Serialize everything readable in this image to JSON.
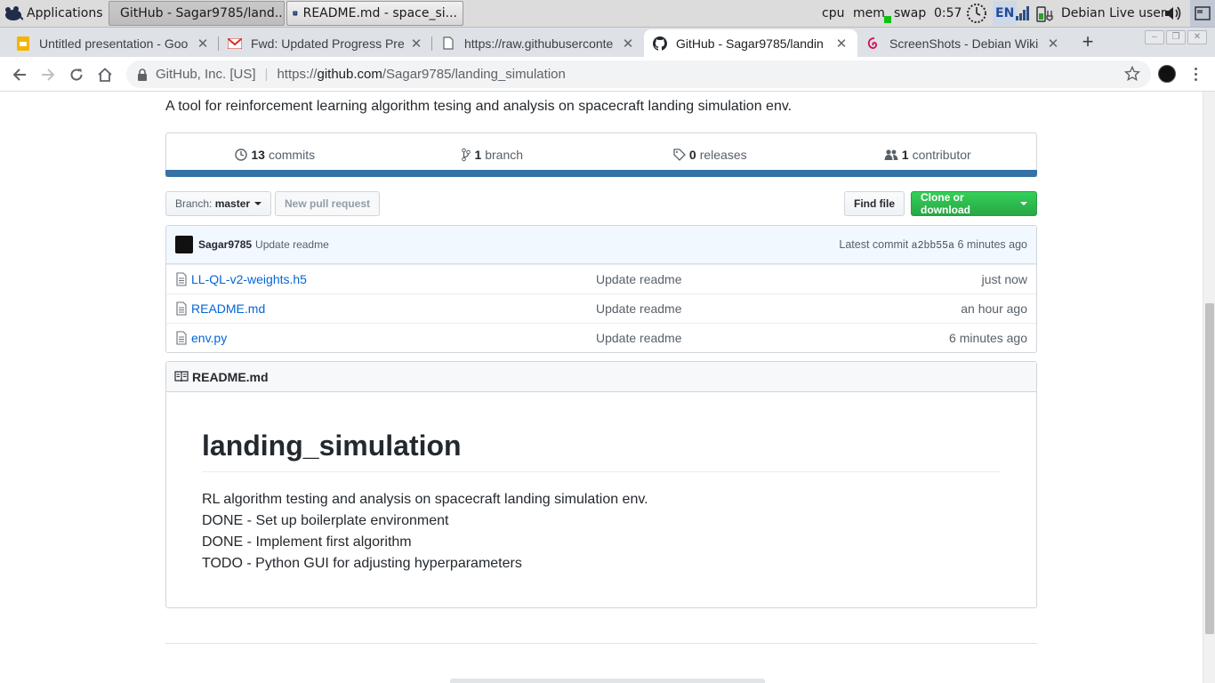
{
  "panel": {
    "applications_label": "Applications",
    "tasks": [
      {
        "label": "GitHub - Sagar9785/land..."
      },
      {
        "label": "README.md - space_si..."
      }
    ],
    "cpu_label": "cpu",
    "mem_label": "mem",
    "swap_label": "swap",
    "clock": "0:57",
    "keyboard_layout": "EN",
    "user": "Debian Live user"
  },
  "browser": {
    "tabs": [
      {
        "title": "Untitled presentation - Goo",
        "icon": "slides-icon"
      },
      {
        "title": "Fwd: Updated Progress Pre",
        "icon": "gmail-icon"
      },
      {
        "title": "https://raw.githubuserconte",
        "icon": "document-icon"
      },
      {
        "title": "GitHub - Sagar9785/landin",
        "icon": "github-icon",
        "active": true
      },
      {
        "title": "ScreenShots - Debian Wiki",
        "icon": "debian-icon"
      }
    ],
    "close_glyph": "✕",
    "new_tab_glyph": "+",
    "omnibox": {
      "org": "GitHub, Inc. [US]",
      "url_scheme": "https://",
      "url_host": "github.com",
      "url_path": "/Sagar9785/landing_simulation"
    }
  },
  "repo": {
    "description": "A tool for reinforcement learning algorithm tesing and analysis on spacecraft landing simulation env.",
    "summary": {
      "commits_count": "13",
      "commits_label": "commits",
      "branch_count": "1",
      "branch_label": "branch",
      "releases_count": "0",
      "releases_label": "releases",
      "contributor_count": "1",
      "contributor_label": "contributor"
    },
    "language_color": "#3572a5",
    "branch_button_prefix": "Branch:",
    "branch_name": "master",
    "new_pull_request": "New pull request",
    "find_file": "Find file",
    "clone_or_download": "Clone or download",
    "latest_commit": {
      "author": "Sagar9785",
      "message": "Update readme",
      "prefix": "Latest commit",
      "sha": "a2bb55a",
      "age": "6 minutes ago"
    },
    "files": [
      {
        "name": "LL-QL-v2-weights.h5",
        "message": "Update readme",
        "age": "just now"
      },
      {
        "name": "README.md",
        "message": "Update readme",
        "age": "an hour ago"
      },
      {
        "name": "env.py",
        "message": "Update readme",
        "age": "6 minutes ago"
      }
    ],
    "readme": {
      "header": "README.md",
      "title": "landing_simulation",
      "lines": [
        "RL algorithm testing and analysis on spacecraft landing simulation env.",
        "DONE - Set up boilerplate environment",
        "DONE - Implement first algorithm",
        "TODO - Python GUI for adjusting hyperparameters"
      ]
    }
  }
}
